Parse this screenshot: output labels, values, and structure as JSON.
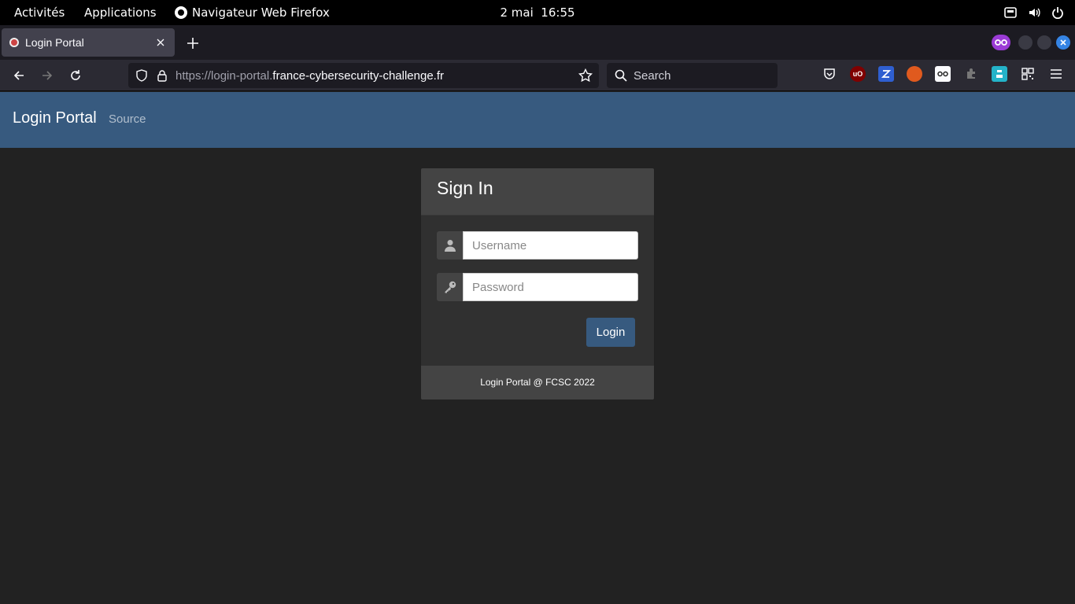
{
  "gnome": {
    "activities": "Activités",
    "applications": "Applications",
    "app_name": "Navigateur Web Firefox",
    "date": "2 mai",
    "time": "16:55"
  },
  "browser": {
    "tab_title": "Login Portal",
    "url_prefix": "https://login-portal.",
    "url_domain": "france-cybersecurity-challenge.fr",
    "search_placeholder": "Search",
    "ext_ublock": "uO"
  },
  "site": {
    "brand": "Login Portal",
    "nav_source": "Source"
  },
  "card": {
    "title": "Sign In",
    "username_placeholder": "Username",
    "password_placeholder": "Password",
    "login_label": "Login",
    "footer": "Login Portal @ FCSC 2022"
  },
  "colors": {
    "navbar": "#375a7f",
    "background": "#222222",
    "card": "#303030"
  }
}
